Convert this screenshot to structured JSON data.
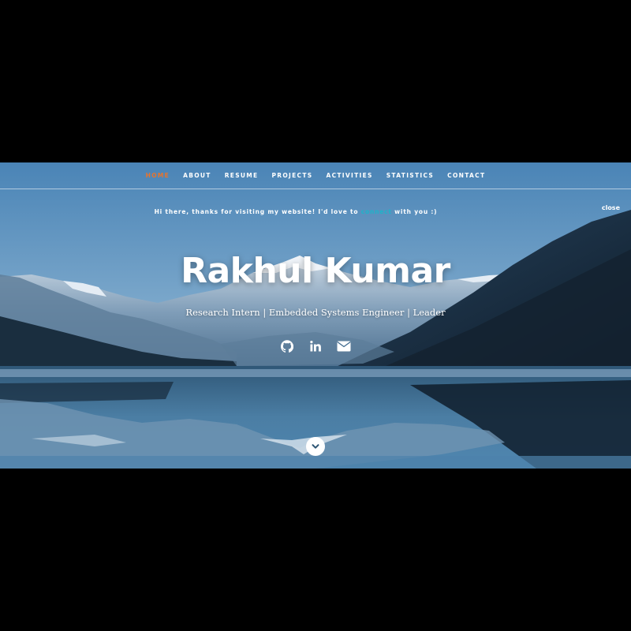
{
  "nav": {
    "items": [
      {
        "label": "HOME",
        "active": true
      },
      {
        "label": "ABOUT",
        "active": false
      },
      {
        "label": "RESUME",
        "active": false
      },
      {
        "label": "PROJECTS",
        "active": false
      },
      {
        "label": "ACTIVITIES",
        "active": false
      },
      {
        "label": "STATISTICS",
        "active": false
      },
      {
        "label": "CONTACT",
        "active": false
      }
    ]
  },
  "banner": {
    "text_before": "Hi there, thanks for visiting my website! I'd love to ",
    "link_text": "connect",
    "text_after": " with you :)",
    "close_label": "close"
  },
  "hero": {
    "name": "Rakhul Kumar",
    "tagline": "Research Intern | Embedded Systems Engineer | Leader"
  },
  "social_icons": [
    "github-icon",
    "linkedin-icon",
    "envelope-icon"
  ],
  "scroll_icon": "chevron-down-icon",
  "colors": {
    "accent_active": "#e8742c",
    "link": "#1fb3c9",
    "text": "#ffffff",
    "background": "#000000"
  }
}
